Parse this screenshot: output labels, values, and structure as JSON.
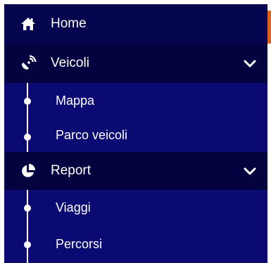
{
  "menu": {
    "home": {
      "label": "Home",
      "icon": "home-icon"
    },
    "veicoli": {
      "label": "Veicoli",
      "icon": "satellite-dish-icon",
      "expanded": true,
      "items": [
        {
          "label": "Mappa"
        },
        {
          "label": "Parco veicoli"
        }
      ]
    },
    "report": {
      "label": "Report",
      "icon": "pie-chart-icon",
      "expanded": true,
      "items": [
        {
          "label": "Viaggi"
        },
        {
          "label": "Percorsi"
        }
      ]
    }
  },
  "colors": {
    "panel": "#0a0a72",
    "section_header": "#03033f",
    "top_item": "#050550",
    "accent": "#d9631f",
    "text": "#ffffff"
  }
}
